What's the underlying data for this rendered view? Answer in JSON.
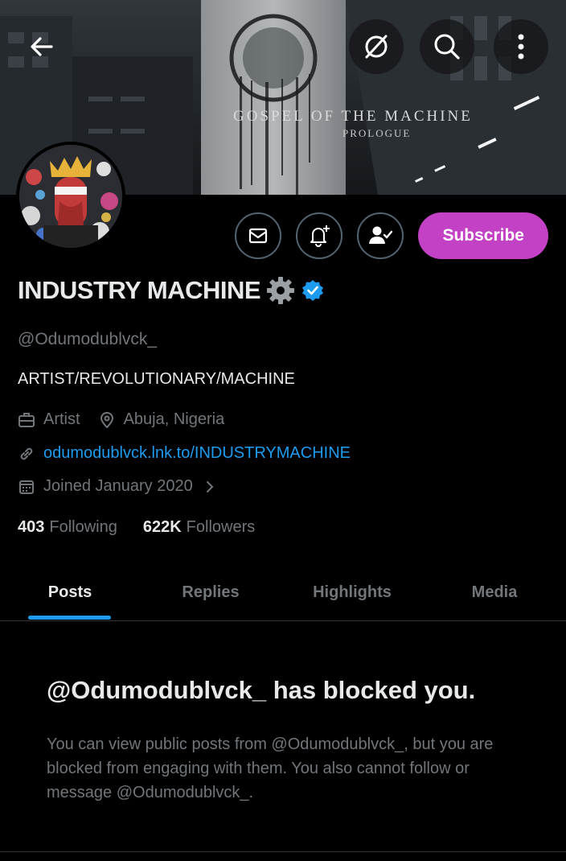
{
  "banner": {
    "title": "GOSPEL OF THE MACHINE",
    "subtitle": "PROLOGUE"
  },
  "topbar": {
    "back_icon": "arrow-left-icon",
    "grok_icon": "slashed-circle-icon",
    "search_icon": "search-icon",
    "more_icon": "more-vertical-icon"
  },
  "actions": {
    "message_icon": "envelope-icon",
    "notify_icon": "bell-plus-icon",
    "follow_icon": "person-check-icon",
    "subscribe_label": "Subscribe"
  },
  "profile": {
    "name": "INDUSTRY MACHINE",
    "handle": "@Odumodublvck_",
    "bio": "ARTIST/REVOLUTIONARY/MACHINE",
    "category": "Artist",
    "location": "Abuja, Nigeria",
    "website": "odumodublvck.lnk.to/INDUSTRYMACHINE",
    "joined": "Joined January 2020",
    "following_count": "403",
    "following_label": "Following",
    "followers_count": "622K",
    "followers_label": "Followers"
  },
  "tabs": [
    {
      "label": "Posts"
    },
    {
      "label": "Replies"
    },
    {
      "label": "Highlights"
    },
    {
      "label": "Media"
    }
  ],
  "blocked": {
    "title": "@Odumodublvck_ has blocked you.",
    "message": "You can view public posts from @Odumodublvck_, but you are blocked from engaging with them. You also cannot follow or message @Odumodublvck_."
  },
  "colors": {
    "accent": "#1d9bf0",
    "subscribe": "#c341c5",
    "muted": "#71767b"
  }
}
